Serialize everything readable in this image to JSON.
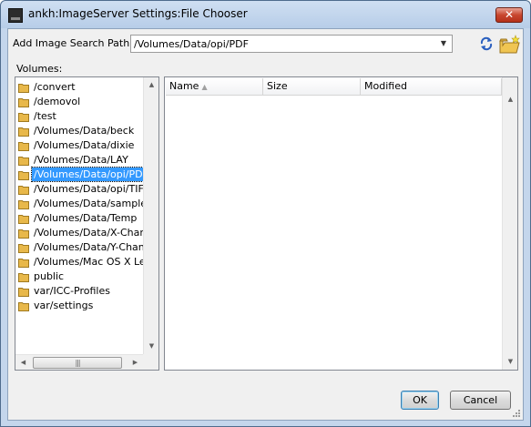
{
  "window": {
    "title": "ankh:ImageServer Settings:File Chooser",
    "close_label": "✕"
  },
  "path": {
    "label": "Add Image Search Path:",
    "value": "/Volumes/Data/opi/PDF"
  },
  "icons": {
    "refresh": "refresh-icon",
    "new_folder": "new-folder-icon",
    "folder": "folder-icon"
  },
  "volumes": {
    "label": "Volumes:",
    "items": [
      "/convert",
      "/demovol",
      "/test",
      "/Volumes/Data/beck",
      "/Volumes/Data/dixie",
      "/Volumes/Data/LAY",
      "/Volumes/Data/opi/PDF",
      "/Volumes/Data/opi/TIFF",
      "/Volumes/Data/sample-images",
      "/Volumes/Data/Temp",
      "/Volumes/Data/X-Change",
      "/Volumes/Data/Y-Change",
      "/Volumes/Mac OS X Leo/ImageServer",
      "public",
      "var/ICC-Profiles",
      "var/settings"
    ],
    "selected_index": 6
  },
  "files": {
    "columns": [
      "Name",
      "Size",
      "Modified"
    ],
    "sorted_column": "Name",
    "rows": []
  },
  "buttons": {
    "ok": "OK",
    "cancel": "Cancel"
  },
  "colors": {
    "selection": "#3399ff",
    "folder": "#e8b84a"
  }
}
